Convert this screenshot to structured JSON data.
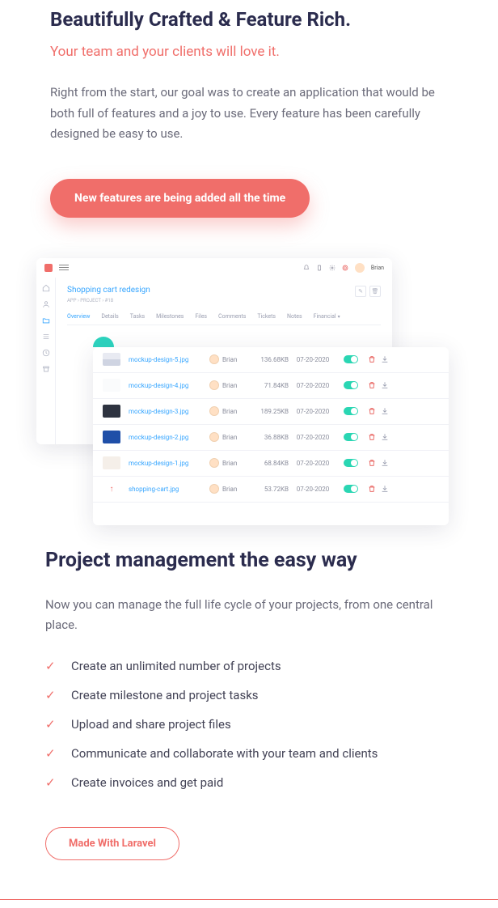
{
  "hero": {
    "title": "Beautifully Crafted & Feature Rich.",
    "subtitle": "Your team and your clients will love it.",
    "body": "Right from the start, our goal was to create an application that would be both full of features and a joy to use. Every feature has been carefully designed be easy to use.",
    "cta": "New features are being added all the time"
  },
  "mockup": {
    "user": "Brian",
    "project_title": "Shopping cart redesign",
    "breadcrumb": "APP  ›  PROJECT  ›  #18",
    "tabs": [
      "Overview",
      "Details",
      "Tasks",
      "Milestones",
      "Files",
      "Comments",
      "Tickets",
      "Notes",
      "Financial"
    ],
    "files": [
      {
        "thumb": "c1",
        "name": "mockup-design-5.jpg",
        "uploader": "Brian",
        "size": "136.68KB",
        "date": "07-20-2020"
      },
      {
        "thumb": "c2",
        "name": "mockup-design-4.jpg",
        "uploader": "Brian",
        "size": "71.84KB",
        "date": "07-20-2020"
      },
      {
        "thumb": "c3",
        "name": "mockup-design-3.jpg",
        "uploader": "Brian",
        "size": "189.25KB",
        "date": "07-20-2020"
      },
      {
        "thumb": "c4",
        "name": "mockup-design-2.jpg",
        "uploader": "Brian",
        "size": "36.88KB",
        "date": "07-20-2020"
      },
      {
        "thumb": "c5",
        "name": "mockup-design-1.jpg",
        "uploader": "Brian",
        "size": "68.84KB",
        "date": "07-20-2020"
      },
      {
        "thumb": "c6",
        "name": "shopping-cart.jpg",
        "uploader": "Brian",
        "size": "53.72KB",
        "date": "07-20-2020"
      }
    ]
  },
  "section2": {
    "title": "Project management the easy way",
    "body": "Now you can manage the full life cycle of your projects, from one central place.",
    "features": [
      "Create an unlimited number of projects",
      "Create milestone and project tasks",
      "Upload and share project files",
      "Communicate and collaborate with your team and clients",
      "Create invoices and get paid"
    ],
    "cta": "Made With Laravel"
  }
}
